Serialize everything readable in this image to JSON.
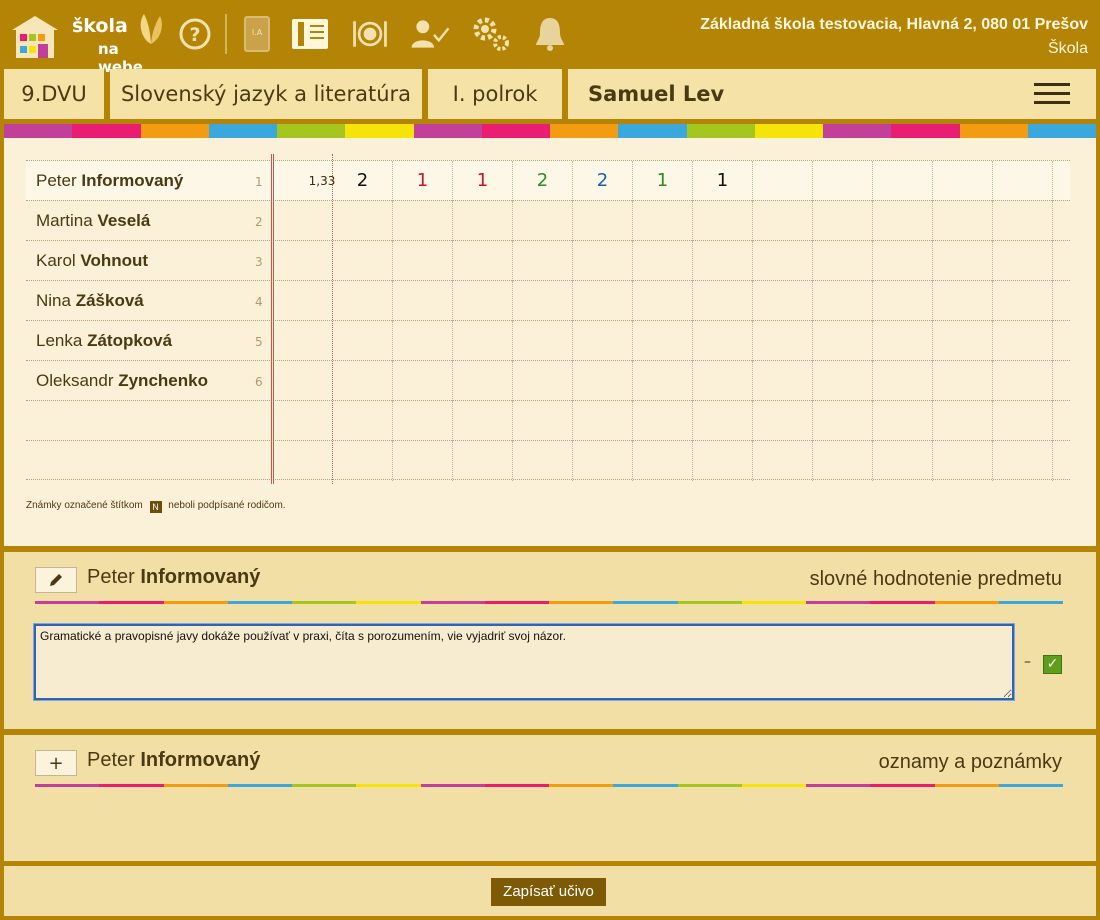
{
  "header": {
    "logo_line1": "škola",
    "logo_line2": "na webe",
    "school_name": "Základná škola testovacia, Hlavná 2, 080 01 Prešov",
    "role": "Škola"
  },
  "tabs": {
    "class": "9.DVU",
    "subject": "Slovenský jazyk a literatúra",
    "term": "I. polrok",
    "user": "Samuel Lev"
  },
  "stripe_colors": [
    "#c2409a",
    "#e91e73",
    "#f39c12",
    "#3aa8dc",
    "#a5c61f",
    "#f5e30a",
    "#c2409a",
    "#e91e73",
    "#f39c12",
    "#3aa8dc",
    "#a5c61f",
    "#f5e30a",
    "#c2409a",
    "#e91e73",
    "#f39c12",
    "#3aa8dc"
  ],
  "students": [
    {
      "first": "Peter",
      "last": "Informovaný",
      "num": "1",
      "avg": "1,33",
      "grades": [
        {
          "v": "2",
          "color": "#111111"
        },
        {
          "v": "1",
          "color": "#c0162c"
        },
        {
          "v": "1",
          "color": "#c0162c"
        },
        {
          "v": "2",
          "color": "#2e8b24"
        },
        {
          "v": "2",
          "color": "#1a5fb4"
        },
        {
          "v": "1",
          "color": "#2e8b24"
        },
        {
          "v": "1",
          "color": "#111111"
        }
      ]
    },
    {
      "first": "Martina",
      "last": "Veselá",
      "num": "2",
      "avg": "",
      "grades": []
    },
    {
      "first": "Karol",
      "last": "Vohnout",
      "num": "3",
      "avg": "",
      "grades": []
    },
    {
      "first": "Nina",
      "last": "Zášková",
      "num": "4",
      "avg": "",
      "grades": []
    },
    {
      "first": "Lenka",
      "last": "Zátopková",
      "num": "5",
      "avg": "",
      "grades": []
    },
    {
      "first": "Oleksandr",
      "last": "Zynchenko",
      "num": "6",
      "avg": "",
      "grades": []
    }
  ],
  "legend": {
    "before": "Známky označené štítkom",
    "badge": "N",
    "after": "neboli podpísané rodičom."
  },
  "evaluation": {
    "first": "Peter",
    "last": "Informovaný",
    "title": "slovné hodnotenie predmetu",
    "text": "Gramatické a pravopisné javy dokáže používať v praxi, číta s porozumením, vie vyjadriť svoj názor.",
    "dash": "–",
    "check": "✓"
  },
  "notes": {
    "first": "Peter",
    "last": "Informovaný",
    "title": "oznamy a poznámky",
    "add": "+"
  },
  "save_button": "Zapísať učivo"
}
